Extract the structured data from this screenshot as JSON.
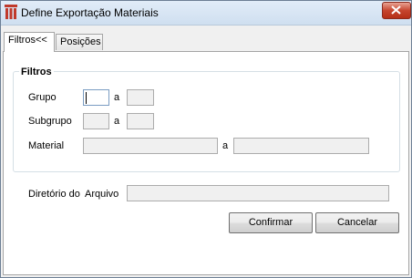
{
  "window": {
    "title": "Define Exportação Materiais",
    "icon": "app-logo-icon",
    "close_icon": "close-icon"
  },
  "tabs": [
    {
      "label": "Filtros<<",
      "active": true
    },
    {
      "label": "Posições",
      "active": false
    }
  ],
  "filters": {
    "group_title": "Filtros",
    "grupo_label": "Grupo",
    "subgrupo_label": "Subgrupo",
    "material_label": "Material",
    "range_sep": "a",
    "grupo_from": "",
    "grupo_to": "",
    "subgrupo_from": "",
    "subgrupo_to": "",
    "material_from": "",
    "material_to": ""
  },
  "directory": {
    "label_part1": "Diretório do",
    "label_part2": "Arquivo",
    "value": ""
  },
  "buttons": {
    "confirm": "Confirmar",
    "cancel": "Cancelar"
  },
  "colors": {
    "close_button": "#c6452e",
    "app_icon": "#c0392b"
  }
}
